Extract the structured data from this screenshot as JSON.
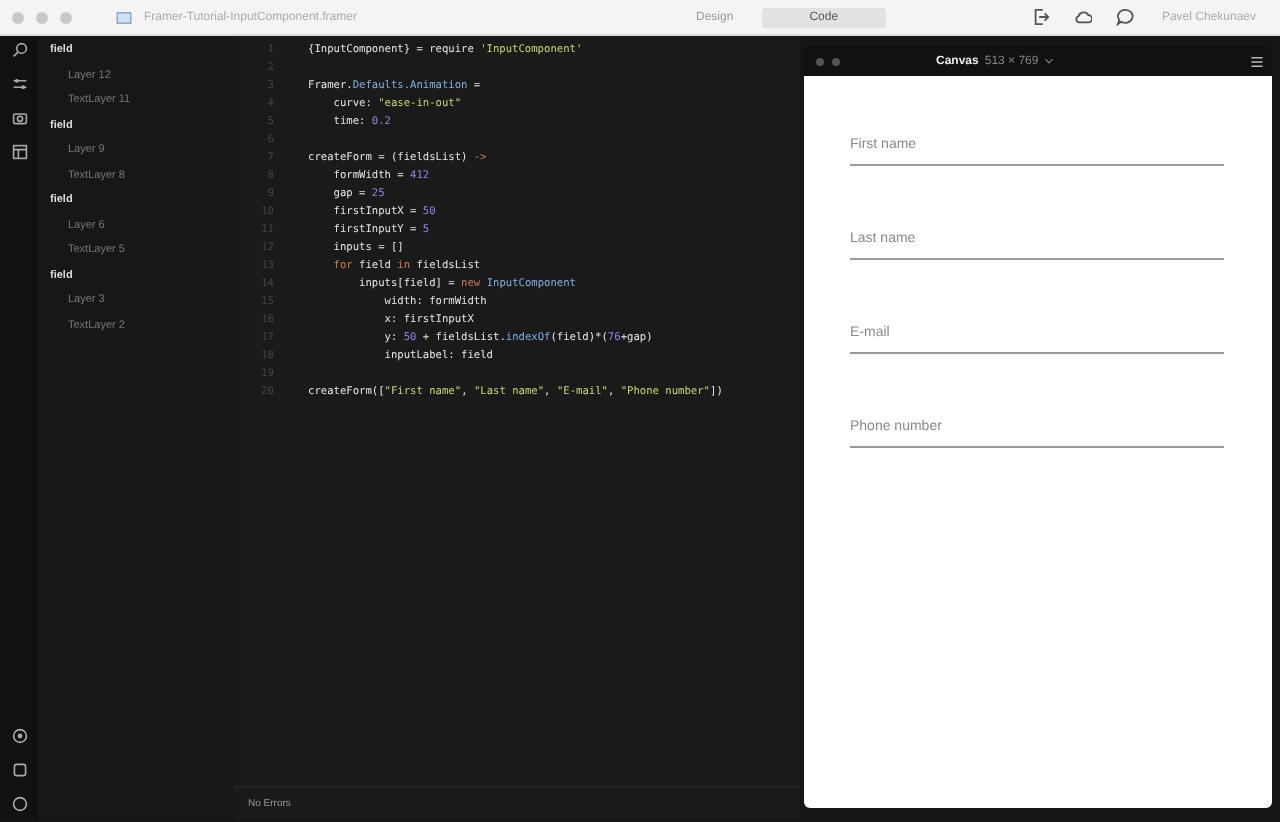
{
  "window": {
    "title": "Framer-Tutorial-InputComponent.framer",
    "user": "Pavel Chekunaev"
  },
  "mode_tabs": [
    {
      "label": "Design",
      "selected": false
    },
    {
      "label": "Code",
      "selected": true
    }
  ],
  "layers": [
    {
      "name": "field",
      "children": [
        {
          "name": "Layer 12"
        },
        {
          "name": "TextLayer 11"
        }
      ]
    },
    {
      "name": "field",
      "children": [
        {
          "name": "Layer 9"
        },
        {
          "name": "TextLayer 8"
        }
      ]
    },
    {
      "name": "field",
      "children": [
        {
          "name": "Layer 6"
        },
        {
          "name": "TextLayer 5"
        }
      ]
    },
    {
      "name": "field",
      "children": [
        {
          "name": "Layer 3"
        },
        {
          "name": "TextLayer 2"
        }
      ]
    }
  ],
  "code": {
    "lines": [
      {
        "number": "1",
        "segments": [
          {
            "text": "{InputComponent} = require ",
            "kind": "plain"
          },
          {
            "text": "'InputComponent'",
            "kind": "string"
          }
        ]
      },
      {
        "number": "2"
      },
      {
        "number": "3",
        "segments": [
          {
            "text": "Framer.",
            "kind": "plain"
          },
          {
            "text": "Defaults.Animation",
            "kind": "class"
          },
          {
            "text": " =",
            "kind": "plain"
          }
        ]
      },
      {
        "number": "4",
        "segments": [
          {
            "text": "    curve: ",
            "kind": "plain"
          },
          {
            "text": "\"ease-in-out\"",
            "kind": "string"
          }
        ]
      },
      {
        "number": "5",
        "segments": [
          {
            "text": "    time: ",
            "kind": "plain"
          },
          {
            "text": "0.2",
            "kind": "number"
          }
        ]
      },
      {
        "number": "6"
      },
      {
        "number": "7",
        "segments": [
          {
            "text": "createForm = (fieldsList) ",
            "kind": "plain"
          },
          {
            "text": "->",
            "kind": "keyword"
          }
        ]
      },
      {
        "number": "8",
        "segments": [
          {
            "text": "    formWidth = ",
            "kind": "plain"
          },
          {
            "text": "412",
            "kind": "number"
          }
        ]
      },
      {
        "number": "9",
        "segments": [
          {
            "text": "    gap = ",
            "kind": "plain"
          },
          {
            "text": "25",
            "kind": "number"
          }
        ]
      },
      {
        "number": "10",
        "segments": [
          {
            "text": "    firstInputX = ",
            "kind": "plain"
          },
          {
            "text": "50",
            "kind": "number"
          }
        ]
      },
      {
        "number": "11",
        "segments": [
          {
            "text": "    firstInputY = ",
            "kind": "plain"
          },
          {
            "text": "5",
            "kind": "number"
          }
        ]
      },
      {
        "number": "12",
        "segments": [
          {
            "text": "    inputs = []",
            "kind": "plain"
          }
        ]
      },
      {
        "number": "13",
        "segments": [
          {
            "text": "    for",
            "kind": "keyword"
          },
          {
            "text": " field ",
            "kind": "plain"
          },
          {
            "text": "in",
            "kind": "keyword"
          },
          {
            "text": " fieldsList",
            "kind": "plain"
          }
        ]
      },
      {
        "number": "14",
        "segments": [
          {
            "text": "        inputs[field] = ",
            "kind": "plain"
          },
          {
            "text": "new",
            "kind": "keyword"
          },
          {
            "text": " InputComponent",
            "kind": "class"
          }
        ]
      },
      {
        "number": "15",
        "segments": [
          {
            "text": "            width: formWidth",
            "kind": "plain"
          }
        ]
      },
      {
        "number": "16",
        "segments": [
          {
            "text": "            x: firstInputX",
            "kind": "plain"
          }
        ]
      },
      {
        "number": "17",
        "segments": [
          {
            "text": "            y: ",
            "kind": "plain"
          },
          {
            "text": "50",
            "kind": "number"
          },
          {
            "text": " + fieldsList.",
            "kind": "plain"
          },
          {
            "text": "indexOf",
            "kind": "class"
          },
          {
            "text": "(field)*(",
            "kind": "plain"
          },
          {
            "text": "76",
            "kind": "number"
          },
          {
            "text": "+gap)",
            "kind": "plain"
          }
        ]
      },
      {
        "number": "18",
        "segments": [
          {
            "text": "            inputLabel: field",
            "kind": "plain"
          }
        ]
      },
      {
        "number": "19"
      },
      {
        "number": "20",
        "segments": [
          {
            "text": "createForm([",
            "kind": "plain"
          },
          {
            "text": "\"First name\"",
            "kind": "string"
          },
          {
            "text": ", ",
            "kind": "plain"
          },
          {
            "text": "\"Last name\"",
            "kind": "string"
          },
          {
            "text": ", ",
            "kind": "plain"
          },
          {
            "text": "\"E-mail\"",
            "kind": "string"
          },
          {
            "text": ", ",
            "kind": "plain"
          },
          {
            "text": "\"Phone number\"",
            "kind": "string"
          },
          {
            "text": "])",
            "kind": "plain"
          }
        ]
      }
    ]
  },
  "canvas": {
    "title": "Canvas",
    "size": "513 × 769",
    "fields": [
      {
        "label": "First name"
      },
      {
        "label": "Last name"
      },
      {
        "label": "E-mail"
      },
      {
        "label": "Phone number"
      }
    ]
  },
  "status_bar": {
    "text": "No Errors"
  }
}
